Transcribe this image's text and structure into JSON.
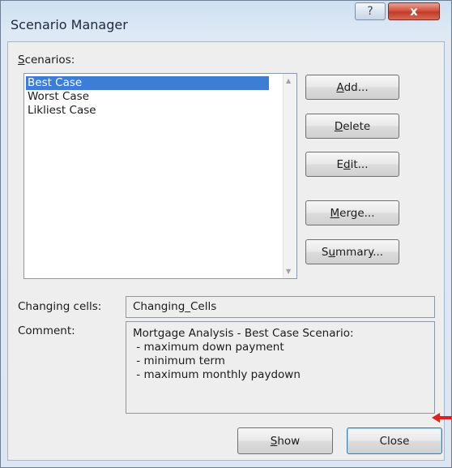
{
  "window": {
    "title": "Scenario Manager",
    "help_glyph": "?",
    "close_glyph": "x"
  },
  "scenarios": {
    "label_first": "S",
    "label_rest": "cenarios:",
    "items": [
      "Best Case",
      "Worst Case",
      "Likliest Case"
    ],
    "selected_index": 0
  },
  "buttons": {
    "add": {
      "u": "A",
      "rest": "dd..."
    },
    "delete": {
      "u": "D",
      "rest": "elete"
    },
    "edit": {
      "pre": "E",
      "u": "d",
      "rest": "it..."
    },
    "merge": {
      "u": "M",
      "rest": "erge..."
    },
    "summary": {
      "pre": "S",
      "u": "u",
      "rest": "mmary..."
    },
    "show": {
      "u": "S",
      "rest": "how"
    },
    "close": "Close"
  },
  "changing_cells": {
    "label": "Changing cells:",
    "value": "Changing_Cells"
  },
  "comment": {
    "label": "Comment:",
    "lines": [
      "Mortgage Analysis - Best Case Scenario:",
      " - maximum down payment",
      " - minimum term",
      " - maximum monthly paydown"
    ]
  },
  "colors": {
    "selection": "#3c7dd6",
    "close_button": "#c23b26",
    "annotation_arrow": "#d9231c"
  },
  "icons": {
    "help": "help-icon",
    "close": "close-icon",
    "scroll_up": "scroll-up-arrow-icon",
    "scroll_down": "scroll-down-arrow-icon",
    "annotation": "red-arrow-icon"
  }
}
